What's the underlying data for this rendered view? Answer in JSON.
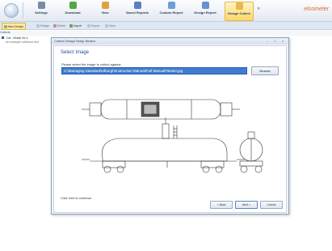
{
  "ribbon": {
    "buttons": [
      {
        "label": "Settings",
        "icon": "gear-icon",
        "color": "#7a8aa8"
      },
      {
        "label": "Download",
        "icon": "download-icon",
        "color": "#4fa84a"
      },
      {
        "label": "View",
        "icon": "view-icon",
        "color": "#d9a441"
      },
      {
        "label": "Saved Reports",
        "icon": "report-icon",
        "color": "#5b7fc2"
      },
      {
        "label": "Custom Report",
        "icon": "custom-report-icon",
        "color": "#6d9ed8"
      },
      {
        "label": "Design Report",
        "icon": "design-report-icon",
        "color": "#6a8fcf"
      },
      {
        "label": "Design Collect",
        "icon": "design-collect-icon",
        "color": "#e9b949"
      }
    ],
    "brand": "elcometer"
  },
  "toolbar": {
    "items": [
      "New Design",
      "Design",
      "Delete",
      "Import",
      "Export",
      "Save"
    ]
  },
  "panel": {
    "header": "Collects"
  },
  "tree": {
    "title": "Car : Model 4X-4",
    "subtitle": "An example collection test"
  },
  "dialog": {
    "title": "Collect Design Setup Wizard",
    "controls": "– □ ×",
    "heading": "Select Image",
    "prompt": "Please select the image to collect against:",
    "path_value": "C:\\Managing Standard\\edburgh\\Instruction Manual\\Full Manual\\Tanker.jpg",
    "browse_label": "Browse",
    "hint": "Click next to continue",
    "back_label": "< Back",
    "next_label": "Next >",
    "cancel_label": "Cancel"
  }
}
